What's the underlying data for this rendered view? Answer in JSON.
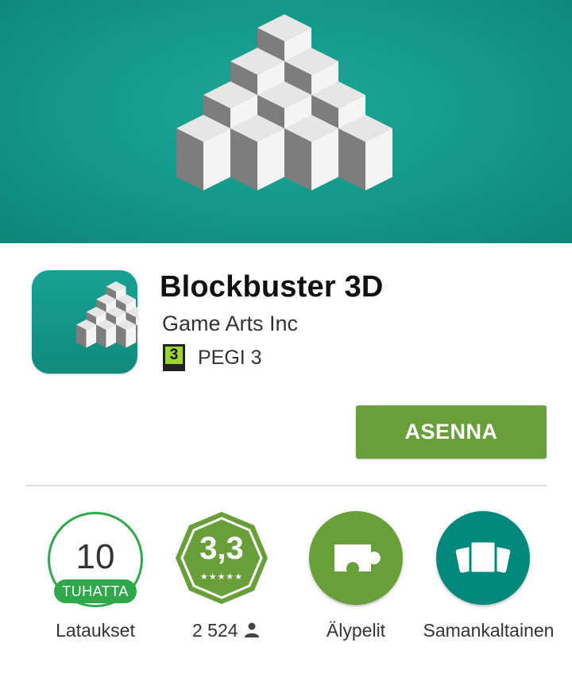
{
  "app": {
    "title": "Blockbuster 3D",
    "developer": "Game Arts Inc",
    "content_rating": {
      "badge": "3",
      "label": "PEGI 3"
    }
  },
  "actions": {
    "install_label": "ASENNA"
  },
  "stats": {
    "downloads": {
      "number": "10",
      "unit": "TUHATTA",
      "caption": "Lataukset"
    },
    "rating": {
      "value": "3,3",
      "stars": "★★★★★",
      "count": "2 524",
      "count_icon": "person-icon"
    },
    "category": {
      "caption": "Älypelit",
      "icon": "puzzle-piece-icon"
    },
    "similar": {
      "caption": "Samankaltainen",
      "icon": "cards-stack-icon"
    }
  },
  "colors": {
    "banner": "#169a8c",
    "install_button": "#689f38",
    "downloads_ring": "#2ea84a",
    "rating_badge": "#689f38",
    "category_circle": "#689f38",
    "similar_circle": "#00897b"
  }
}
